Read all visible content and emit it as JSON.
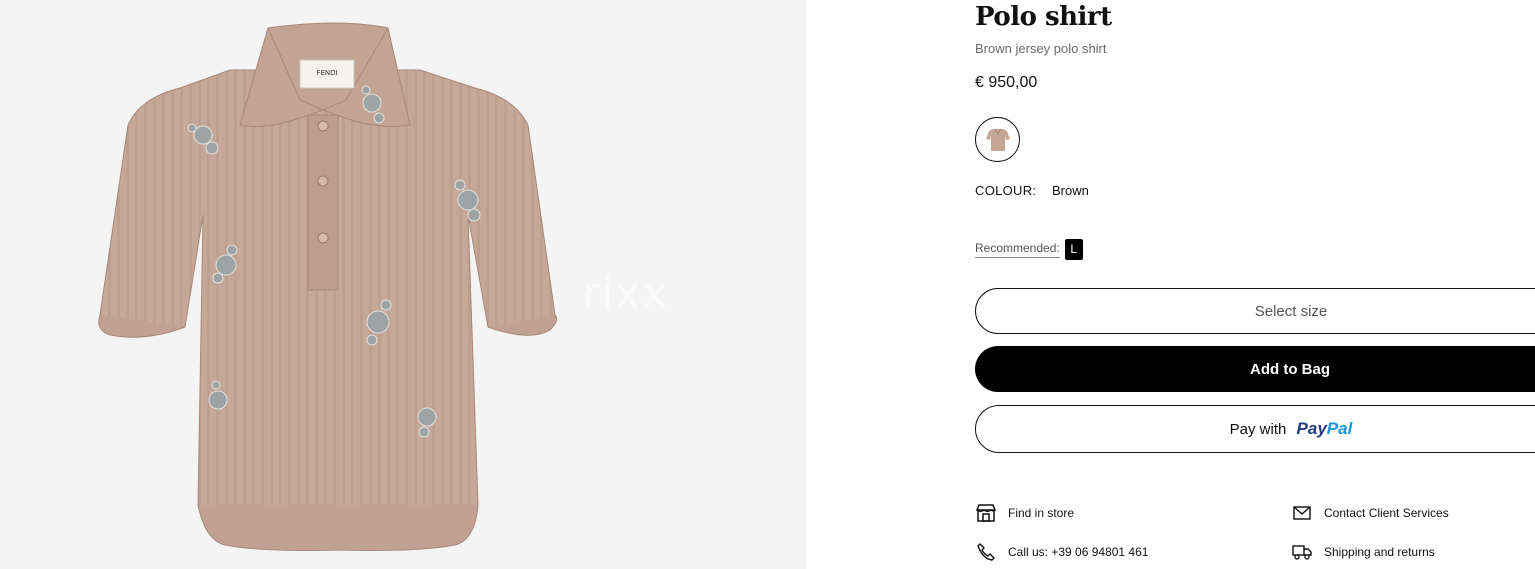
{
  "product": {
    "title": "Polo shirt",
    "subtitle": "Brown jersey polo shirt",
    "price": "€ 950,00",
    "image_watermark": "rixx",
    "label_brand": "FENDI",
    "colour_label": "COLOUR:",
    "colour_value": "Brown"
  },
  "size": {
    "recommended_label": "Recommended:",
    "recommended_value": "L",
    "select_placeholder": "Select size"
  },
  "actions": {
    "add_to_bag": "Add to Bag",
    "pay_with": "Pay with",
    "paypal_part1": "Pay",
    "paypal_part2": "Pal"
  },
  "services": {
    "find_in_store": "Find in store",
    "contact": "Contact Client Services",
    "call": "Call us: +39 06 94801 461",
    "shipping": "Shipping and returns"
  },
  "icons": {
    "store": "store-icon",
    "mail": "mail-icon",
    "phone": "phone-icon",
    "truck": "truck-icon"
  },
  "colors": {
    "shirt": "#c4a596",
    "shirt_shadow": "#b08f80",
    "background": "#f4f4f4",
    "button_primary": "#000000"
  }
}
